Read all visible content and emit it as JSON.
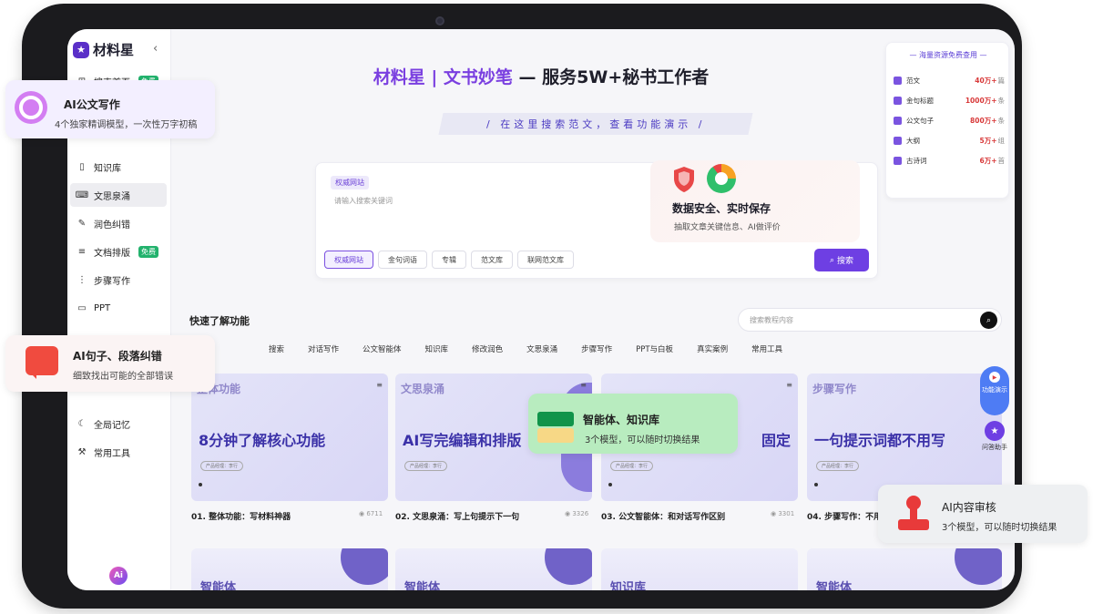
{
  "sidebar": {
    "logo_text": "材料星",
    "collapse_glyph": "‹",
    "items": [
      {
        "label": "搜索首页",
        "badge": "免费",
        "icon": "grid-icon"
      },
      {
        "label": "知识库",
        "badge": "",
        "icon": "book-icon"
      },
      {
        "label": "文思泉涌",
        "badge": "",
        "icon": "keyboard-icon"
      },
      {
        "label": "润色纠错",
        "badge": "",
        "icon": "pen-icon"
      },
      {
        "label": "文档排版",
        "badge": "免费",
        "icon": "list-icon"
      },
      {
        "label": "步骤写作",
        "badge": "",
        "icon": "steps-icon"
      },
      {
        "label": "PPT",
        "badge": "",
        "icon": "monitor-icon"
      },
      {
        "label": "全局记忆",
        "badge": "",
        "icon": "memory-icon"
      },
      {
        "label": "常用工具",
        "badge": "",
        "icon": "wrench-icon"
      }
    ]
  },
  "header": {
    "brand": "材料星 | 文书妙笔",
    "dash": " — ",
    "tagline": "服务5W+秘书工作者",
    "banner": "/ 在这里搜索范文，查看功能演示 /"
  },
  "search": {
    "chip": "权威网站",
    "placeholder": "请输入搜索关键词",
    "tabs": [
      "权威网站",
      "金句词语",
      "专辑",
      "范文库",
      "联网范文库"
    ],
    "button": "搜索"
  },
  "security_card": {
    "title": "数据安全、实时保存",
    "subtitle": "抽取文章关键信息、AI做评价"
  },
  "stats": {
    "header": "海量资源免费查用",
    "rows": [
      {
        "label": "范文",
        "value": "40万+",
        "unit": "篇"
      },
      {
        "label": "金句标题",
        "value": "1000万+",
        "unit": "条"
      },
      {
        "label": "公文句子",
        "value": "800万+",
        "unit": "条"
      },
      {
        "label": "大纲",
        "value": "5万+",
        "unit": "组"
      },
      {
        "label": "古诗词",
        "value": "6万+",
        "unit": "首"
      }
    ]
  },
  "quick": {
    "title": "快速了解功能",
    "search_placeholder": "搜索教程内容",
    "categories": [
      "搜索",
      "对话写作",
      "公文智能体",
      "知识库",
      "修改润色",
      "文思泉涌",
      "步骤写作",
      "PPT与白板",
      "真实案例",
      "常用工具"
    ],
    "cards": [
      {
        "tag": "整体功能",
        "headline": "8分钟了解核心功能",
        "title": "01. 整体功能：写材料神器",
        "views": "6711"
      },
      {
        "tag": "文思泉涌",
        "headline": "AI写完编辑和排版",
        "title": "02. 文思泉涌：写上句提示下一句",
        "views": "3326"
      },
      {
        "tag": "",
        "headline": "固定",
        "title": "03. 公文智能体：和对话写作区别",
        "views": "3301"
      },
      {
        "tag": "步骤写作",
        "headline": "一句提示词都不用写",
        "title": "04. 步骤写作：不用写",
        "views": ""
      }
    ],
    "bottom_cards": [
      "智能体",
      "智能体",
      "知识库",
      "智能体"
    ],
    "pill": "产品经理：李行"
  },
  "float": {
    "demo": "功能演示",
    "help": "问答助手"
  },
  "callouts": {
    "c1_title": "AI公文写作",
    "c1_sub": "4个独家精调模型，一次性万字初稿",
    "c2_title": "AI句子、段落纠错",
    "c2_sub": "细致找出可能的全部错误",
    "c3_title": "智能体、知识库",
    "c3_sub": "3个模型，可以随时切换结果",
    "c4_title": "AI内容审核",
    "c4_sub": "3个模型，可以随时切换结果"
  }
}
